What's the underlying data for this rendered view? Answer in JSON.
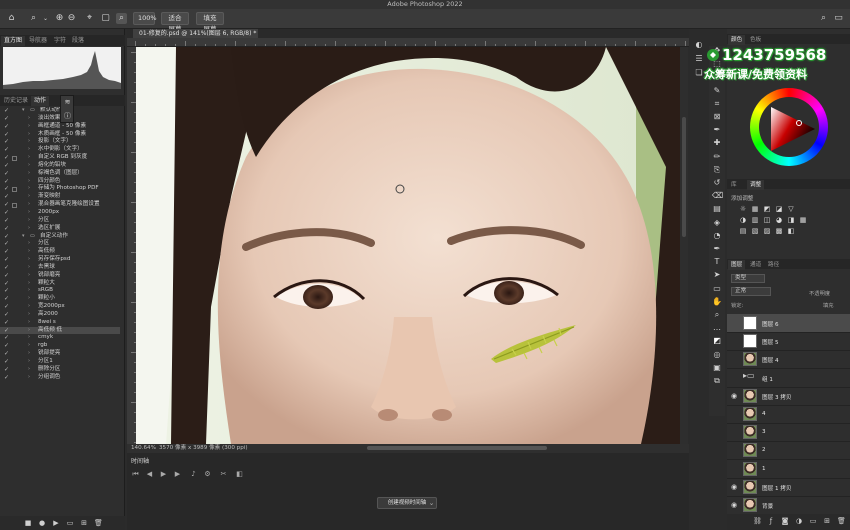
{
  "app": {
    "title": "Adobe Photoshop 2022"
  },
  "options_bar": {
    "zoom_value": "100%",
    "fit_screen": "适合屏幕",
    "fill_screen": "填充屏幕"
  },
  "left_panel": {
    "top_tabs": [
      "直方图",
      "导航器",
      "字符",
      "段落"
    ],
    "actions_tabs": [
      "历史记录",
      "动作"
    ],
    "actions": [
      {
        "checked": true,
        "dialog": false,
        "indent": 0,
        "expand": "open",
        "label": "默认动作",
        "folder": true
      },
      {
        "checked": true,
        "dialog": false,
        "indent": 1,
        "label": "淡出效果"
      },
      {
        "checked": true,
        "dialog": false,
        "indent": 1,
        "label": "画框通道 - 50 像素"
      },
      {
        "checked": true,
        "dialog": false,
        "indent": 1,
        "label": "木质画框 - 50 像素"
      },
      {
        "checked": true,
        "dialog": false,
        "indent": 1,
        "label": "投影（文字）"
      },
      {
        "checked": true,
        "dialog": false,
        "indent": 1,
        "label": "水中倒影（文字）"
      },
      {
        "checked": true,
        "dialog": true,
        "indent": 1,
        "label": "自定义 RGB 到灰度"
      },
      {
        "checked": true,
        "dialog": false,
        "indent": 1,
        "label": "熔化的铅块"
      },
      {
        "checked": true,
        "dialog": false,
        "indent": 1,
        "label": "棕褐色调（图层）"
      },
      {
        "checked": true,
        "dialog": false,
        "indent": 1,
        "label": "四分颜色"
      },
      {
        "checked": true,
        "dialog": true,
        "indent": 1,
        "label": "存储为 Photoshop PDF"
      },
      {
        "checked": true,
        "dialog": false,
        "indent": 1,
        "label": "渐变映射"
      },
      {
        "checked": true,
        "dialog": true,
        "indent": 1,
        "label": "混合器画笔克隆绘图设置"
      },
      {
        "checked": true,
        "dialog": false,
        "indent": 1,
        "label": "2000px"
      },
      {
        "checked": true,
        "dialog": false,
        "indent": 1,
        "label": "分区"
      },
      {
        "checked": true,
        "dialog": false,
        "indent": 1,
        "label": "选区扩展"
      },
      {
        "checked": true,
        "dialog": false,
        "indent": 0,
        "expand": "open",
        "label": "自定义动作",
        "folder": true
      },
      {
        "checked": true,
        "dialog": false,
        "indent": 1,
        "label": "分区"
      },
      {
        "checked": true,
        "dialog": false,
        "indent": 1,
        "label": "高低频"
      },
      {
        "checked": true,
        "dialog": false,
        "indent": 1,
        "label": "另存保存psd"
      },
      {
        "checked": true,
        "dialog": false,
        "indent": 1,
        "label": "去黑球"
      },
      {
        "checked": true,
        "dialog": false,
        "indent": 1,
        "label": "锐部磨亮"
      },
      {
        "checked": true,
        "dialog": false,
        "indent": 1,
        "label": "颗粒大"
      },
      {
        "checked": true,
        "dialog": false,
        "indent": 1,
        "label": "sRGB"
      },
      {
        "checked": true,
        "dialog": false,
        "indent": 1,
        "label": "颗粒小"
      },
      {
        "checked": true,
        "dialog": false,
        "indent": 1,
        "label": "宽2000px"
      },
      {
        "checked": true,
        "dialog": false,
        "indent": 1,
        "label": "高2000"
      },
      {
        "checked": true,
        "dialog": false,
        "indent": 1,
        "label": "8wei s"
      },
      {
        "checked": true,
        "dialog": false,
        "indent": 1,
        "label": "高低频 低",
        "selected": true
      },
      {
        "checked": true,
        "dialog": false,
        "indent": 1,
        "label": "cmyk"
      },
      {
        "checked": true,
        "dialog": false,
        "indent": 1,
        "label": "rgb"
      },
      {
        "checked": true,
        "dialog": false,
        "indent": 1,
        "label": "锐部提亮"
      },
      {
        "checked": true,
        "dialog": false,
        "indent": 1,
        "label": "分区1"
      },
      {
        "checked": true,
        "dialog": false,
        "indent": 1,
        "label": "删除分区"
      },
      {
        "checked": true,
        "dialog": false,
        "indent": 1,
        "label": "分组调色"
      }
    ]
  },
  "document": {
    "tab_title": "01-修复的.psd @ 141%(图层 6, RGB/8) *",
    "status_zoom": "140.64%",
    "status_info": "3570 像素 x 3989 像素 (300 ppi)"
  },
  "timeline": {
    "title": "时间轴",
    "create_button": "创建视频时间轴"
  },
  "right_panel": {
    "color_tabs": [
      "颜色",
      "色板"
    ],
    "adjust_tabs": [
      "库",
      "调整"
    ],
    "adjust_label": "添加调整",
    "layers_tabs": [
      "图层",
      "通道",
      "路径"
    ],
    "filter_kind": "类型",
    "blend_mode": "正常",
    "opacity_label": "不透明度",
    "lock_label": "锁定:",
    "fill_label": "填充",
    "layers": [
      {
        "name": "图层 6",
        "visible": false,
        "thumb": "white",
        "selected": true
      },
      {
        "name": "图层 5",
        "visible": false,
        "thumb": "white"
      },
      {
        "name": "图层 4",
        "visible": false,
        "thumb": "face"
      },
      {
        "name": "组 1",
        "visible": false,
        "thumb": "folder"
      },
      {
        "name": "图层 3 拷贝",
        "visible": true,
        "thumb": "face"
      },
      {
        "name": "4",
        "visible": false,
        "thumb": "face"
      },
      {
        "name": "3",
        "visible": false,
        "thumb": "face"
      },
      {
        "name": "2",
        "visible": false,
        "thumb": "face"
      },
      {
        "name": "1",
        "visible": false,
        "thumb": "face"
      },
      {
        "name": "图层 1 拷贝",
        "visible": true,
        "thumb": "face"
      },
      {
        "name": "背景",
        "visible": true,
        "thumb": "face"
      }
    ]
  },
  "watermark": {
    "phone": "1243759568",
    "text": "众筹新课/免费领资料"
  },
  "colors": {
    "accent": "#2a9a32",
    "panel_bg": "#2e2e2e",
    "selected": "#4b4b4b"
  }
}
